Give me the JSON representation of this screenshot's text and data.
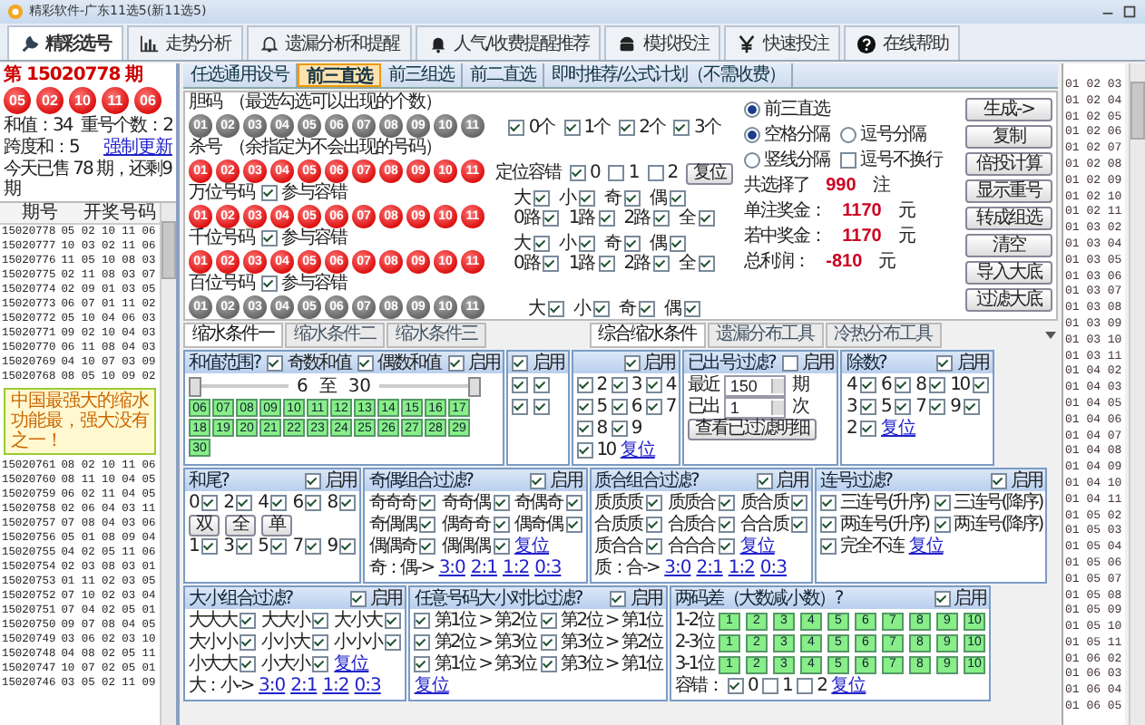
{
  "window": {
    "title": "精彩软件-广东11选5(新11选5)"
  },
  "toolbar": [
    {
      "label": "精彩选号",
      "selected": true
    },
    {
      "label": "走势分析",
      "selected": false
    },
    {
      "label": "遗漏分析和提醒",
      "selected": false
    },
    {
      "label": "人气/收费提醒推荐",
      "selected": false
    },
    {
      "label": "模拟投注",
      "selected": false
    },
    {
      "label": "快速投注",
      "selected": false
    },
    {
      "label": "在线帮助",
      "selected": false
    }
  ],
  "draw": {
    "issue": "第 15020778 期",
    "balls": [
      "05",
      "02",
      "10",
      "11",
      "06"
    ],
    "lines": [
      [
        {
          "kind": "text",
          "text": "和值：34"
        },
        {
          "kind": "text",
          "text": "重号个数：2"
        }
      ],
      [
        {
          "kind": "text",
          "text": "跨度和：5"
        },
        {
          "kind": "link",
          "text": "强制更新"
        }
      ],
      [
        {
          "kind": "text",
          "text": "今天已售 78 期，还剩9期"
        }
      ]
    ]
  },
  "history": {
    "columns": [
      "期号",
      "开奖号码"
    ],
    "rows_above": [
      [
        "15020778",
        "05 02 10 11 06"
      ],
      [
        "15020777",
        "10 03 02 11 06"
      ],
      [
        "15020776",
        "11 05 10 08 03"
      ],
      [
        "15020775",
        "02 11 08 03 07"
      ],
      [
        "15020774",
        "02 09 01 03 05"
      ],
      [
        "15020773",
        "06 07 01 11 02"
      ],
      [
        "15020772",
        "05 10 04 06 03"
      ],
      [
        "15020771",
        "09 02 10 04 03"
      ],
      [
        "15020770",
        "06 11 08 04 03"
      ],
      [
        "15020769",
        "04 10 07 03 09"
      ],
      [
        "15020768",
        "08 05 10 09 02"
      ]
    ],
    "callout": "中国最强大的缩水功能最，强大没有之一！",
    "rows_below": [
      [
        "15020761",
        "08 02 10 11 06"
      ],
      [
        "15020760",
        "08 11 10 04 05"
      ],
      [
        "15020759",
        "06 02 11 04 05"
      ],
      [
        "15020758",
        "02 06 04 03 11"
      ],
      [
        "15020757",
        "07 08 04 03 06"
      ],
      [
        "15020756",
        "05 01 08 09 04"
      ],
      [
        "15020755",
        "04 02 05 11 06"
      ],
      [
        "15020754",
        "02 03 08 03 01"
      ],
      [
        "15020753",
        "01 11 02 03 05"
      ],
      [
        "15020752",
        "07 10 02 03 04"
      ],
      [
        "15020751",
        "07 04 02 05 01"
      ],
      [
        "15020750",
        "09 07 08 04 05"
      ],
      [
        "15020749",
        "03 06 02 03 10"
      ],
      [
        "15020748",
        "04 08 02 05 11"
      ],
      [
        "15020747",
        "10 07 02 05 01"
      ],
      [
        "15020746",
        "03 05 02 11 09"
      ]
    ]
  },
  "subtabs": [
    {
      "label": "任选通用设号",
      "selected": false
    },
    {
      "label": "前三直选",
      "selected": true
    },
    {
      "label": "前三组选",
      "selected": false
    },
    {
      "label": "前二直选",
      "selected": false
    },
    {
      "label": "即时推荐/公式计划（不需收费）",
      "selected": false
    }
  ],
  "sections": [
    {
      "title": "胆码",
      "hint": "（最选勾选可以出现的个数）",
      "kind": "plain",
      "balls": [
        "01",
        "02",
        "03",
        "04",
        "05",
        "06",
        "07",
        "08",
        "09",
        "10",
        "11"
      ],
      "side": [
        [
          {
            "kind": "check",
            "label": "0个",
            "checked": true
          },
          {
            "kind": "check",
            "label": "1个",
            "checked": true
          },
          {
            "kind": "check",
            "label": "2个",
            "checked": true
          },
          {
            "kind": "check",
            "label": "3个",
            "checked": true
          }
        ]
      ]
    },
    {
      "title": "杀号",
      "hint": "（余指定为不会出现的号码）",
      "kind": "marked",
      "balls": [
        "01",
        "02",
        "03",
        "04",
        "05",
        "06",
        "07",
        "08",
        "09",
        "10",
        "11"
      ],
      "side": [
        [
          {
            "kind": "text",
            "text": "定位容错"
          },
          {
            "kind": "check",
            "label": "0",
            "checked": true
          },
          {
            "kind": "check",
            "label": "1",
            "checked": false
          },
          {
            "kind": "check",
            "label": "2",
            "checked": false
          },
          {
            "kind": "button",
            "text": "复位"
          }
        ]
      ]
    },
    {
      "title": "万位号码",
      "option": {
        "label": "参与容错",
        "checked": true
      },
      "kind": "marked",
      "balls": [
        "01",
        "02",
        "03",
        "04",
        "05",
        "06",
        "07",
        "08",
        "09",
        "10",
        "11"
      ],
      "side": [
        [
          {
            "kind": "check_r",
            "label": "大",
            "checked": true
          },
          {
            "kind": "check_r",
            "label": "小",
            "checked": true
          },
          {
            "kind": "check_r",
            "label": "奇",
            "checked": true
          },
          {
            "kind": "check_r",
            "label": "偶",
            "checked": true
          }
        ],
        [
          {
            "kind": "check_r",
            "label": "0路",
            "checked": true
          },
          {
            "kind": "check_r",
            "label": "1路",
            "checked": true
          },
          {
            "kind": "check_r",
            "label": "2路",
            "checked": true
          },
          {
            "kind": "check_r",
            "label": "全",
            "checked": true
          }
        ]
      ]
    },
    {
      "title": "千位号码",
      "option": {
        "label": "参与容错",
        "checked": true
      },
      "kind": "marked",
      "balls": [
        "01",
        "02",
        "03",
        "04",
        "05",
        "06",
        "07",
        "08",
        "09",
        "10",
        "11"
      ],
      "side": [
        [
          {
            "kind": "check_r",
            "label": "大",
            "checked": true
          },
          {
            "kind": "check_r",
            "label": "小",
            "checked": true
          },
          {
            "kind": "check_r",
            "label": "奇",
            "checked": true
          },
          {
            "kind": "check_r",
            "label": "偶",
            "checked": true
          }
        ],
        [
          {
            "kind": "check_r",
            "label": "0路",
            "checked": true
          },
          {
            "kind": "check_r",
            "label": "1路",
            "checked": true
          },
          {
            "kind": "check_r",
            "label": "2路",
            "checked": true
          },
          {
            "kind": "check_r",
            "label": "全",
            "checked": true
          }
        ]
      ]
    },
    {
      "title": "百位号码",
      "option": {
        "label": "参与容错",
        "checked": true
      },
      "kind": "plain",
      "balls": [
        "01",
        "02",
        "03",
        "04",
        "05",
        "06",
        "07",
        "08",
        "09",
        "10",
        "11"
      ],
      "side": [
        [
          {
            "kind": "check_r",
            "label": "大",
            "checked": true
          },
          {
            "kind": "check_r",
            "label": "小",
            "checked": true
          },
          {
            "kind": "check_r",
            "label": "奇",
            "checked": true
          },
          {
            "kind": "check_r",
            "label": "偶",
            "checked": true
          }
        ]
      ]
    }
  ],
  "options": [
    [
      {
        "kind": "radio",
        "label": "前三直选",
        "selected": true
      }
    ],
    [
      {
        "kind": "radio",
        "label": "空格分隔",
        "selected": true
      },
      {
        "kind": "radio",
        "label": "逗号分隔",
        "selected": false
      }
    ],
    [
      {
        "kind": "radio",
        "label": "竖线分隔",
        "selected": false
      },
      {
        "kind": "check",
        "label": "逗号不换行",
        "checked": false
      }
    ],
    [
      {
        "kind": "text",
        "text": "共选择了"
      },
      {
        "kind": "value",
        "text": "990"
      },
      {
        "kind": "text",
        "text": "注"
      }
    ],
    [
      {
        "kind": "text",
        "text": "单注奖金："
      },
      {
        "kind": "value",
        "text": "1170"
      },
      {
        "kind": "text",
        "text": "元"
      }
    ],
    [
      {
        "kind": "text",
        "text": "若中奖金："
      },
      {
        "kind": "value",
        "text": "1170"
      },
      {
        "kind": "text",
        "text": "元"
      }
    ],
    [
      {
        "kind": "text",
        "text": "总利润："
      },
      {
        "kind": "value",
        "text": "-810"
      },
      {
        "kind": "text",
        "text": "元"
      }
    ]
  ],
  "buttons": [
    "生成->",
    "复制",
    "倍投计算",
    "显示重号",
    "转成组选",
    "清空",
    "导入大底",
    "过滤大底"
  ],
  "condition_tabs": {
    "left": [
      {
        "label": "缩水条件一",
        "selected": true
      },
      {
        "label": "缩水条件二",
        "selected": false
      },
      {
        "label": "缩水条件三",
        "selected": false
      }
    ],
    "right": [
      {
        "label": "综合缩水条件",
        "selected": true
      },
      {
        "label": "遗漏分布工具",
        "selected": false
      },
      {
        "label": "冷热分布工具",
        "selected": false
      }
    ]
  },
  "panel_rows": [
    [
      {
        "kind": "range",
        "title": "和值范围?",
        "header": [
          {
            "kind": "check",
            "label": "奇数和值",
            "checked": true
          },
          {
            "kind": "check",
            "label": "偶数和值",
            "checked": true
          },
          {
            "kind": "check",
            "label": "启用",
            "checked": true
          }
        ],
        "range": {
          "values": [
            "6",
            "至",
            "30"
          ],
          "level": 1
        },
        "cells": [
          "06",
          "07",
          "08",
          "09",
          "10",
          "11",
          "12",
          "13",
          "14",
          "15",
          "16",
          "17",
          "18",
          "19",
          "20",
          "21",
          "22",
          "23",
          "24",
          "25",
          "26",
          "27",
          "28",
          "29",
          "30"
        ]
      },
      {
        "kind": "list",
        "header": [
          {
            "kind": "check",
            "label": "启用",
            "checked": true
          }
        ],
        "lines": [
          [
            {
              "kind": "box",
              "checked": true
            },
            {
              "kind": "box",
              "checked": true
            }
          ],
          [
            {
              "kind": "box",
              "checked": true
            },
            {
              "kind": "box",
              "checked": true
            }
          ]
        ]
      },
      {
        "kind": "list",
        "header": [
          {
            "kind": "check",
            "label": "启用",
            "checked": true
          }
        ],
        "lines": [
          [
            {
              "kind": "check",
              "label": "2",
              "checked": true
            },
            {
              "kind": "check",
              "label": "3",
              "checked": true
            },
            {
              "kind": "check",
              "label": "4",
              "checked": true
            }
          ],
          [
            {
              "kind": "check",
              "label": "5",
              "checked": true
            },
            {
              "kind": "check",
              "label": "6",
              "checked": true
            },
            {
              "kind": "check",
              "label": "7",
              "checked": true
            }
          ],
          [
            {
              "kind": "check",
              "label": "8",
              "checked": true
            },
            {
              "kind": "check",
              "label": "9",
              "checked": true
            }
          ],
          [
            {
              "kind": "check",
              "label": "10",
              "checked": true
            },
            {
              "kind": "link",
              "text": "复位"
            }
          ]
        ]
      },
      {
        "kind": "list",
        "title": "已出号过滤?",
        "header": [
          {
            "kind": "check",
            "label": "启用",
            "checked": false
          }
        ],
        "lines": [
          [
            {
              "kind": "text",
              "text": "最近"
            },
            {
              "kind": "field",
              "text": "150"
            },
            {
              "kind": "text",
              "text": "期"
            }
          ],
          [
            {
              "kind": "text",
              "text": "已出"
            },
            {
              "kind": "field",
              "text": "1"
            },
            {
              "kind": "text",
              "text": "次"
            }
          ],
          [
            {
              "kind": "button",
              "text": "查看已过滤明细"
            }
          ]
        ]
      },
      {
        "kind": "list",
        "title": "除数?",
        "header": [
          {
            "kind": "check",
            "label": "启用",
            "checked": true
          }
        ],
        "lines": [
          [
            {
              "kind": "check_r",
              "label": "4",
              "checked": true
            },
            {
              "kind": "check_r",
              "label": "6",
              "checked": true
            },
            {
              "kind": "check_r",
              "label": "8",
              "checked": true
            },
            {
              "kind": "check_r",
              "label": "10",
              "checked": true
            }
          ],
          [
            {
              "kind": "check_r",
              "label": "3",
              "checked": true
            },
            {
              "kind": "check_r",
              "label": "5",
              "checked": true
            },
            {
              "kind": "check_r",
              "label": "7",
              "checked": true
            },
            {
              "kind": "check_r",
              "label": "9",
              "checked": true
            }
          ],
          [
            {
              "kind": "check_r",
              "label": "2",
              "checked": true
            },
            {
              "kind": "link",
              "text": "复位"
            }
          ]
        ]
      }
    ],
    [
      {
        "kind": "list",
        "title": "和尾?",
        "header": [
          {
            "kind": "check",
            "label": "启用",
            "checked": true
          }
        ],
        "lines": [
          [
            {
              "kind": "check_r",
              "label": "0",
              "checked": true
            },
            {
              "kind": "check_r",
              "label": "2",
              "checked": true
            },
            {
              "kind": "check_r",
              "label": "4",
              "checked": true
            },
            {
              "kind": "check_r",
              "label": "6",
              "checked": true
            },
            {
              "kind": "check_r",
              "label": "8",
              "checked": true
            }
          ],
          [
            {
              "kind": "button",
              "text": "双"
            },
            {
              "kind": "button",
              "text": "全"
            },
            {
              "kind": "button",
              "text": "单"
            }
          ],
          [
            {
              "kind": "check_r",
              "label": "1",
              "checked": true
            },
            {
              "kind": "check_r",
              "label": "3",
              "checked": true
            },
            {
              "kind": "check_r",
              "label": "5",
              "checked": true
            },
            {
              "kind": "check_r",
              "label": "7",
              "checked": true
            },
            {
              "kind": "check_r",
              "label": "9",
              "checked": true
            }
          ]
        ]
      },
      {
        "kind": "list",
        "title": "奇偶组合过滤?",
        "header": [
          {
            "kind": "check",
            "label": "启用",
            "checked": true
          }
        ],
        "lines": [
          [
            {
              "kind": "check_r",
              "label": "奇奇奇",
              "checked": true
            },
            {
              "kind": "check_r",
              "label": "奇奇偶",
              "checked": true
            },
            {
              "kind": "check_r",
              "label": "奇偶奇",
              "checked": true
            }
          ],
          [
            {
              "kind": "check_r",
              "label": "奇偶偶",
              "checked": true
            },
            {
              "kind": "check_r",
              "label": "偶奇奇",
              "checked": true
            },
            {
              "kind": "check_r",
              "label": "偶奇偶",
              "checked": true
            }
          ],
          [
            {
              "kind": "check_r",
              "label": "偶偶奇",
              "checked": true
            },
            {
              "kind": "check_r",
              "label": "偶偶偶",
              "checked": true
            },
            {
              "kind": "link",
              "text": "复位"
            }
          ],
          [
            {
              "kind": "text",
              "text": "奇：偶->"
            },
            {
              "kind": "link",
              "text": "3:0"
            },
            {
              "kind": "link",
              "text": "2:1"
            },
            {
              "kind": "link",
              "text": "1:2"
            },
            {
              "kind": "link",
              "text": "0:3"
            }
          ]
        ]
      },
      {
        "kind": "list",
        "title": "质合组合过滤?",
        "header": [
          {
            "kind": "check",
            "label": "启用",
            "checked": true
          }
        ],
        "lines": [
          [
            {
              "kind": "check_r",
              "label": "质质质",
              "checked": true
            },
            {
              "kind": "check_r",
              "label": "质质合",
              "checked": true
            },
            {
              "kind": "check_r",
              "label": "质合质",
              "checked": true
            }
          ],
          [
            {
              "kind": "check_r",
              "label": "合质质",
              "checked": true
            },
            {
              "kind": "check_r",
              "label": "合质合",
              "checked": true
            },
            {
              "kind": "check_r",
              "label": "合合质",
              "checked": true
            }
          ],
          [
            {
              "kind": "check_r",
              "label": "质合合",
              "checked": true
            },
            {
              "kind": "check_r",
              "label": "合合合",
              "checked": true
            },
            {
              "kind": "link",
              "text": "复位"
            }
          ],
          [
            {
              "kind": "text",
              "text": "质：合->"
            },
            {
              "kind": "link",
              "text": "3:0"
            },
            {
              "kind": "link",
              "text": "2:1"
            },
            {
              "kind": "link",
              "text": "1:2"
            },
            {
              "kind": "link",
              "text": "0:3"
            }
          ]
        ]
      },
      {
        "kind": "list",
        "title": "连号过滤?",
        "header": [
          {
            "kind": "check",
            "label": "启用",
            "checked": true
          }
        ],
        "lines": [
          [
            {
              "kind": "check",
              "label": "三连号(升序)",
              "checked": true
            },
            {
              "kind": "check",
              "label": "三连号(降序)",
              "checked": true
            }
          ],
          [
            {
              "kind": "check",
              "label": "两连号(升序)",
              "checked": true
            },
            {
              "kind": "check",
              "label": "两连号(降序)",
              "checked": true
            }
          ],
          [
            {
              "kind": "check",
              "label": "完全不连",
              "checked": true
            },
            {
              "kind": "link",
              "text": "复位"
            }
          ]
        ]
      }
    ],
    [
      {
        "kind": "list",
        "title": "大小组合过滤?",
        "header": [
          {
            "kind": "check",
            "label": "启用",
            "checked": true
          }
        ],
        "lines": [
          [
            {
              "kind": "check_r",
              "label": "大大大",
              "checked": true
            },
            {
              "kind": "check_r",
              "label": "大大小",
              "checked": true
            },
            {
              "kind": "check_r",
              "label": "大小大",
              "checked": true
            }
          ],
          [
            {
              "kind": "check_r",
              "label": "大小小",
              "checked": true
            },
            {
              "kind": "check_r",
              "label": "小小大",
              "checked": true
            },
            {
              "kind": "check_r",
              "label": "小小小",
              "checked": true
            }
          ],
          [
            {
              "kind": "check_r",
              "label": "小大大",
              "checked": true
            },
            {
              "kind": "check_r",
              "label": "小大小",
              "checked": true
            },
            {
              "kind": "link",
              "text": "复位"
            }
          ],
          [
            {
              "kind": "text",
              "text": "大：小->"
            },
            {
              "kind": "link",
              "text": "3:0"
            },
            {
              "kind": "link",
              "text": "2:1"
            },
            {
              "kind": "link",
              "text": "1:2"
            },
            {
              "kind": "link",
              "text": "0:3"
            }
          ]
        ]
      },
      {
        "kind": "list",
        "title": "任意号码大小对比过滤?",
        "header": [
          {
            "kind": "check",
            "label": "启用",
            "checked": true
          }
        ],
        "lines": [
          [
            {
              "kind": "check",
              "label": "第1位 > 第2位",
              "checked": true
            },
            {
              "kind": "check",
              "label": "第2位 > 第1位",
              "checked": true
            }
          ],
          [
            {
              "kind": "check",
              "label": "第2位 > 第3位",
              "checked": true
            },
            {
              "kind": "check",
              "label": "第3位 > 第2位",
              "checked": true
            }
          ],
          [
            {
              "kind": "check",
              "label": "第1位 > 第3位",
              "checked": true
            },
            {
              "kind": "check",
              "label": "第3位 > 第1位",
              "checked": true
            }
          ],
          [
            {
              "kind": "link",
              "text": "复位"
            }
          ]
        ]
      },
      {
        "kind": "list",
        "title": "两码差（大数减小数）?",
        "header": [
          {
            "kind": "check",
            "label": "启用",
            "checked": true
          }
        ],
        "lines": [
          [
            {
              "kind": "text",
              "text": "1-2位"
            },
            {
              "kind": "cell",
              "text": "1"
            },
            {
              "kind": "cell",
              "text": "2"
            },
            {
              "kind": "cell",
              "text": "3"
            },
            {
              "kind": "cell",
              "text": "4"
            },
            {
              "kind": "cell",
              "text": "5"
            },
            {
              "kind": "cell",
              "text": "6"
            },
            {
              "kind": "cell",
              "text": "7"
            },
            {
              "kind": "cell",
              "text": "8"
            },
            {
              "kind": "cell",
              "text": "9"
            },
            {
              "kind": "cell",
              "text": "10"
            }
          ],
          [
            {
              "kind": "text",
              "text": "2-3位"
            },
            {
              "kind": "cell",
              "text": "1"
            },
            {
              "kind": "cell",
              "text": "2"
            },
            {
              "kind": "cell",
              "text": "3"
            },
            {
              "kind": "cell",
              "text": "4"
            },
            {
              "kind": "cell",
              "text": "5"
            },
            {
              "kind": "cell",
              "text": "6"
            },
            {
              "kind": "cell",
              "text": "7"
            },
            {
              "kind": "cell",
              "text": "8"
            },
            {
              "kind": "cell",
              "text": "9"
            },
            {
              "kind": "cell",
              "text": "10"
            }
          ],
          [
            {
              "kind": "text",
              "text": "3-1位"
            },
            {
              "kind": "cell",
              "text": "1"
            },
            {
              "kind": "cell",
              "text": "2"
            },
            {
              "kind": "cell",
              "text": "3"
            },
            {
              "kind": "cell",
              "text": "4"
            },
            {
              "kind": "cell",
              "text": "5"
            },
            {
              "kind": "cell",
              "text": "6"
            },
            {
              "kind": "cell",
              "text": "7"
            },
            {
              "kind": "cell",
              "text": "8"
            },
            {
              "kind": "cell",
              "text": "9"
            },
            {
              "kind": "cell",
              "text": "10"
            }
          ],
          [
            {
              "kind": "text",
              "text": "容错："
            },
            {
              "kind": "check",
              "label": "0",
              "checked": true
            },
            {
              "kind": "check",
              "label": "1",
              "checked": false
            },
            {
              "kind": "check",
              "label": "2",
              "checked": false
            },
            {
              "kind": "link",
              "text": "复位"
            }
          ]
        ]
      }
    ]
  ],
  "results": [
    "01 02 03",
    "01 02 04",
    "01 02 05",
    "01 02 06",
    "01 02 07",
    "01 02 08",
    "01 02 09",
    "01 02 10",
    "01 02 11",
    "01 03 02",
    "01 03 04",
    "01 03 05",
    "01 03 06",
    "01 03 07",
    "01 03 08",
    "01 03 09",
    "01 03 10",
    "01 03 11",
    "01 04 02",
    "01 04 03",
    "01 04 05",
    "01 04 06",
    "01 04 07",
    "01 04 08",
    "01 04 09",
    "01 04 10",
    "01 04 11",
    "01 05 02",
    "01 05 03",
    "01 05 04",
    "01 05 06",
    "01 05 07",
    "01 05 08",
    "01 05 09",
    "01 05 10",
    "01 05 11",
    "01 06 02",
    "01 06 03",
    "01 06 04",
    "01 06 05"
  ]
}
